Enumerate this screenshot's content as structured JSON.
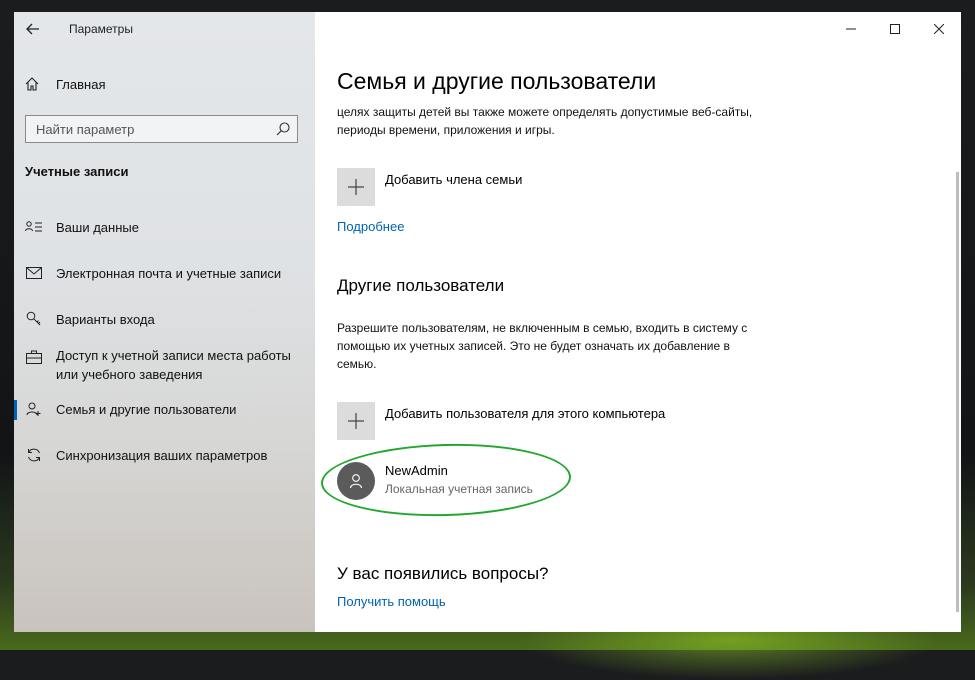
{
  "window": {
    "title": "Параметры",
    "controls": {
      "minimize": "—",
      "maximize": "☐",
      "close": "✕"
    }
  },
  "sidebar": {
    "home_label": "Главная",
    "search": {
      "placeholder": "Найти параметр"
    },
    "section_title": "Учетные записи",
    "items": [
      {
        "label": "Ваши данные",
        "icon": "person-card-icon"
      },
      {
        "label": "Электронная почта и учетные записи",
        "icon": "mail-icon"
      },
      {
        "label": "Варианты входа",
        "icon": "key-icon"
      },
      {
        "label": "Доступ к учетной записи места работы или учебного заведения",
        "icon": "briefcase-icon"
      },
      {
        "label": "Семья и другие пользователи",
        "icon": "person-add-icon",
        "active": true
      },
      {
        "label": "Синхронизация ваших параметров",
        "icon": "sync-icon"
      }
    ]
  },
  "main": {
    "title": "Семья и другие пользователи",
    "family_text": "целях защиты детей вы также можете определять допустимые веб-сайты, периоды времени, приложения и игры.",
    "add_family_label": "Добавить члена семьи",
    "more_link": "Подробнее",
    "other_users_heading": "Другие пользователи",
    "other_users_text": "Разрешите пользователям, не включенным в семью, входить в систему с помощью их учетных записей. Это не будет означать их добавление в семью.",
    "add_user_label": "Добавить пользователя для этого компьютера",
    "user": {
      "name": "NewAdmin",
      "type": "Локальная учетная запись"
    },
    "questions_heading": "У вас появились вопросы?",
    "help_link": "Получить помощь"
  },
  "colors": {
    "accent": "#0063b1",
    "highlight": "#22a82e"
  }
}
